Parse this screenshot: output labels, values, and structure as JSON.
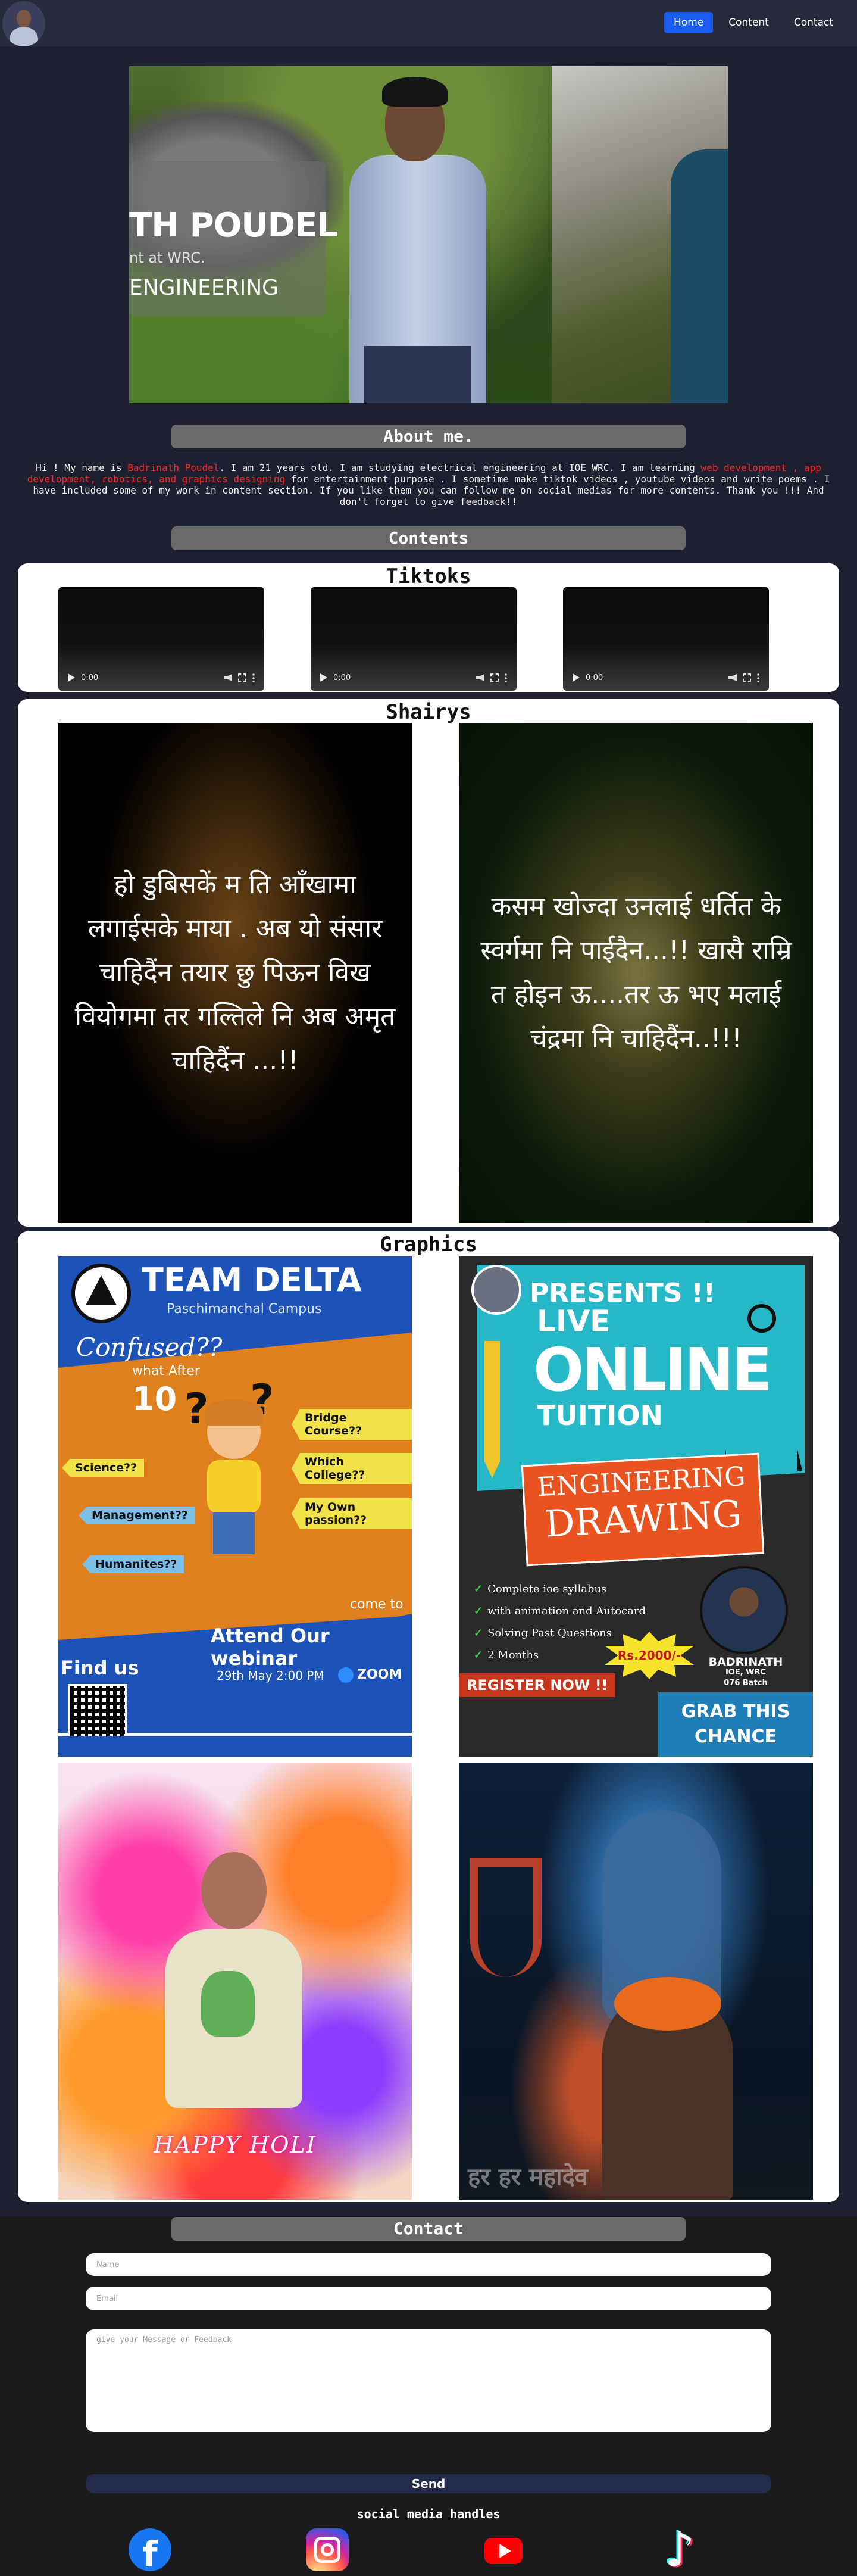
{
  "nav": {
    "links": [
      "Home",
      "Content",
      "Contact"
    ],
    "active": "Home"
  },
  "hero": {
    "name": "TH POUDEL",
    "role": "nt at WRC.",
    "field": "ENGINEERING"
  },
  "about": {
    "title": "About me.",
    "text_1": "Hi ! My name is ",
    "name": "Badrinath Poudel",
    "text_2": ". I am 21 years old. I am studying electrical engineering at IOE WRC. I am learning ",
    "skills": "web development , app development, robotics, and graphics designing",
    "text_3": " for entertainment purpose . I sometime make tiktok videos , youtube videos and write poems . I have included some of my work in content section. If you like them you can follow me on social medias for more contents. Thank you !!! And don't forget to give feedback!!"
  },
  "contents": {
    "title": "Contents",
    "tiktoks": {
      "title": "Tiktoks",
      "videos": [
        {
          "time": "0:00"
        },
        {
          "time": "0:00"
        },
        {
          "time": "0:00"
        }
      ]
    },
    "shairys": {
      "title": "Shairys",
      "poems": [
        "हो डुबिसकें म ति आँखामा लगाईसके माया . अब यो संसार चाहिदैंन तयार छु पिऊन विख वियोगमा तर गल्तिले नि अब अमृत चाहिदैंन ...!!",
        "कसम खोज्दा उनलाई धर्तित के स्वर्गमा नि पाईदैन...!! खासै राम्रि त होइन ऊ....तर ऊ भए मलाई चंद्रमा नि चाहिदैंन..!!!"
      ]
    },
    "graphics": {
      "title": "Graphics",
      "team_delta": {
        "title": "TEAM DELTA",
        "campus": "Paschimanchal Campus",
        "confused": "Confused??",
        "what_after": "what After",
        "ten": "10",
        "tags_left": [
          "Science??",
          "Management??",
          "Humanites??"
        ],
        "tags_right": [
          "Bridge Course??",
          "Which College??",
          "My Own passion??"
        ],
        "come_to": "come to",
        "attend": "Attend Our webinar",
        "find_us": "Find us",
        "date": "29th May   2:00 PM",
        "zoom": "ZOOM"
      },
      "tuition": {
        "presents": "PRESENTS !!",
        "live": "LIVE",
        "online": "ONLINE",
        "tuition": "TUITION",
        "eng_1": "ENGINEERING",
        "eng_2": "DRAWING",
        "features": [
          "Complete ioe syllabus",
          "with animation and Autocard",
          "Solving Past Questions",
          "2 Months"
        ],
        "price": "Rs.2000/-",
        "name": "BADRINATH",
        "org": "IOE, WRC",
        "batch": "076 Batch",
        "register": "REGISTER NOW !!",
        "grab": "GRAB THIS CHANCE"
      },
      "holi": {
        "text": "HAPPY HOLI"
      },
      "shiva": {
        "text": "हर हर महादेव"
      }
    }
  },
  "contact": {
    "title": "Contact",
    "name_placeholder": "Name",
    "email_placeholder": "Email",
    "message_placeholder": "give your Message or Feedback",
    "send": "Send",
    "social_title": "social media handles",
    "social_icons": [
      "facebook-icon",
      "instagram-icon",
      "youtube-icon",
      "tiktok-icon"
    ]
  },
  "colors": {
    "background": "#1d2031",
    "nav_active": "#1b5cf0",
    "highlight": "#ff2424",
    "title_bar": "#6a6a6a"
  }
}
